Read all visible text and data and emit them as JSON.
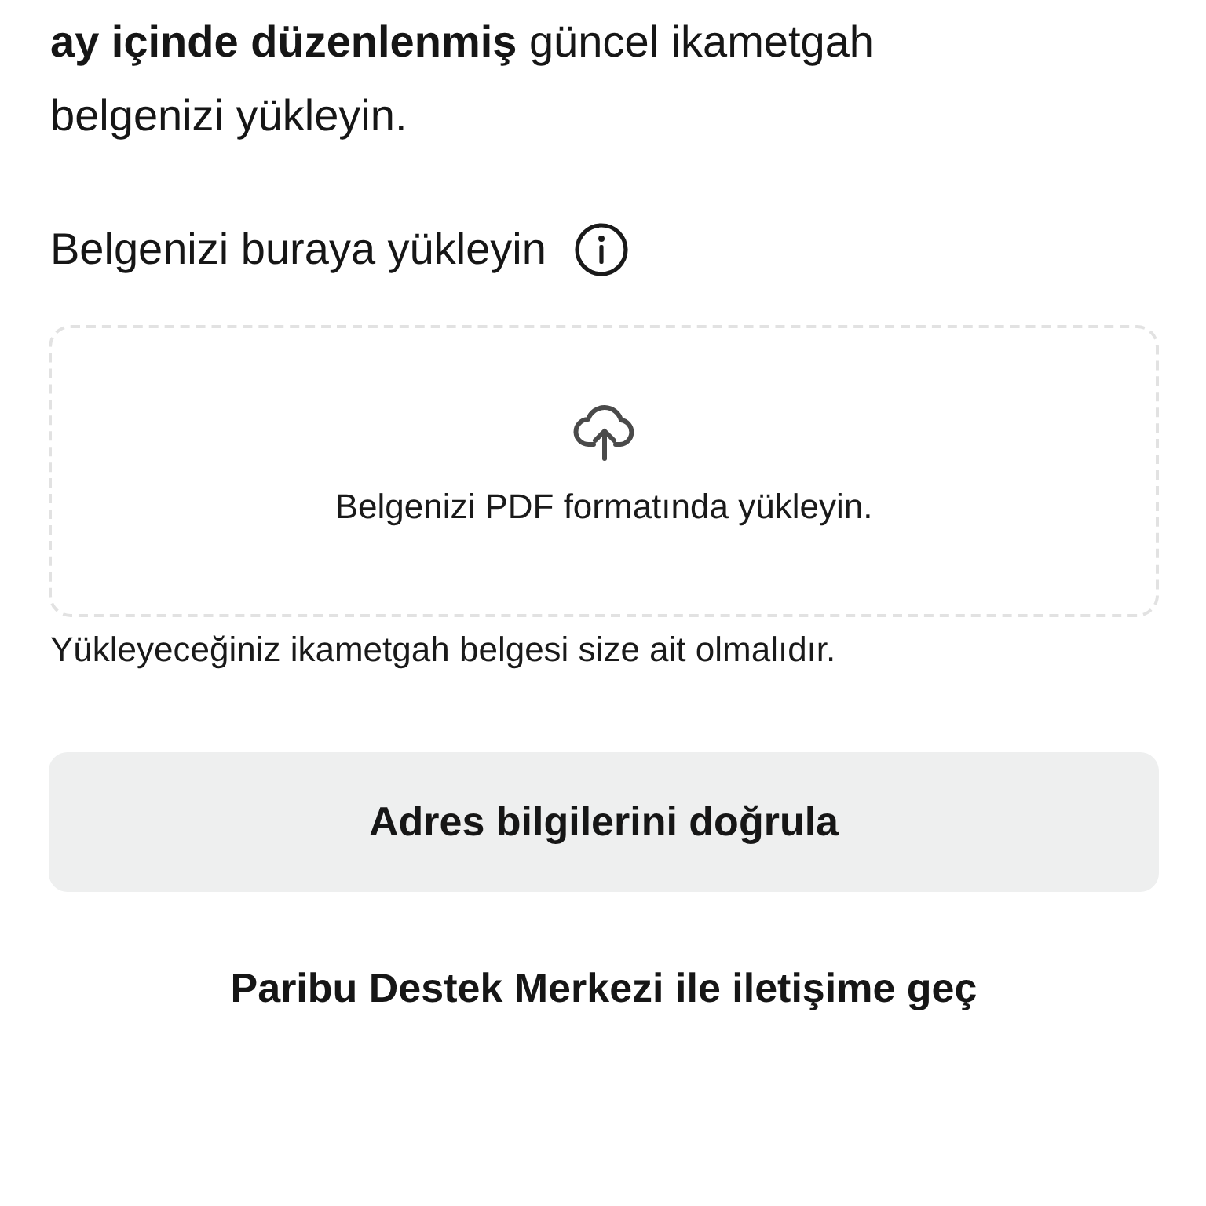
{
  "intro": {
    "text": "**ay içinde düzenlenmiş** güncel ikametgah belgenizi yükleyin."
  },
  "upload": {
    "label": "Belgenizi buraya yükleyin",
    "dropzone_text": "Belgenizi PDF formatında yükleyin.",
    "note": "Yükleyeceğiniz ikametgah belgesi size ait olmalıdır."
  },
  "buttons": [
    {
      "kind": "filled",
      "label": "Adres bilgilerini doğrula"
    },
    {
      "kind": "link",
      "label": "Paribu Destek Merkezi ile iletişime geç"
    }
  ]
}
